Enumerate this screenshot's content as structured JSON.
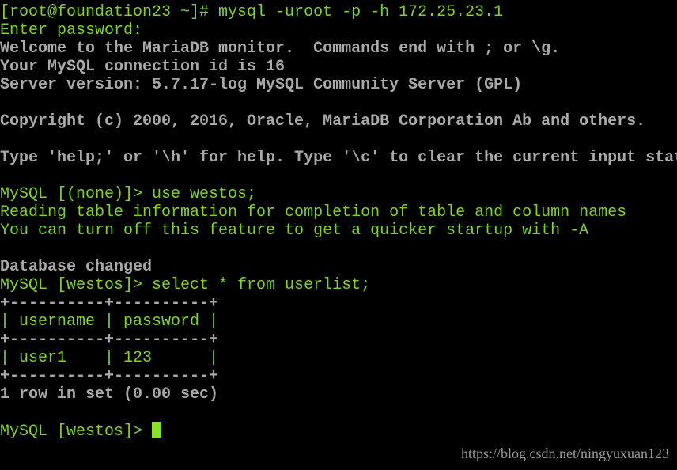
{
  "terminal": {
    "colors": {
      "green": "#7fd22c",
      "gray": "#a9a9a9",
      "background": "#000000"
    },
    "lines": [
      {
        "text": "[root@foundation23 ~]# mysql -uroot -p -h 172.25.23.1",
        "style": "g"
      },
      {
        "text": "Enter password:",
        "style": "g"
      },
      {
        "text": "Welcome to the MariaDB monitor.  Commands end with ; or \\g.",
        "style": "w"
      },
      {
        "text": "Your MySQL connection id is 16",
        "style": "w"
      },
      {
        "text": "Server version: 5.7.17-log MySQL Community Server (GPL)",
        "style": "w"
      },
      {
        "text": "",
        "style": "w"
      },
      {
        "text": "Copyright (c) 2000, 2016, Oracle, MariaDB Corporation Ab and others.",
        "style": "w"
      },
      {
        "text": "",
        "style": "w"
      },
      {
        "text": "Type 'help;' or '\\h' for help. Type '\\c' to clear the current input statement.",
        "style": "w"
      },
      {
        "text": "",
        "style": "w"
      },
      {
        "text": "MySQL [(none)]> use westos;",
        "style": "g"
      },
      {
        "text": "Reading table information for completion of table and column names",
        "style": "g"
      },
      {
        "text": "You can turn off this feature to get a quicker startup with -A",
        "style": "g"
      },
      {
        "text": "",
        "style": "w"
      },
      {
        "text": "Database changed",
        "style": "w"
      },
      {
        "text": "MySQL [westos]> select * from userlist;",
        "style": "g"
      },
      {
        "text": "+----------+----------+",
        "style": "w"
      },
      {
        "text": "| username | password |",
        "style": "g"
      },
      {
        "text": "+----------+----------+",
        "style": "w"
      },
      {
        "text": "| user1    | 123      |",
        "style": "g"
      },
      {
        "text": "+----------+----------+",
        "style": "w"
      },
      {
        "text": "1 row in set (0.00 sec)",
        "style": "w"
      },
      {
        "text": "",
        "style": "w"
      }
    ],
    "prompt": "MySQL [westos]> "
  },
  "watermark": "https://blog.csdn.net/ningyuxuan123"
}
